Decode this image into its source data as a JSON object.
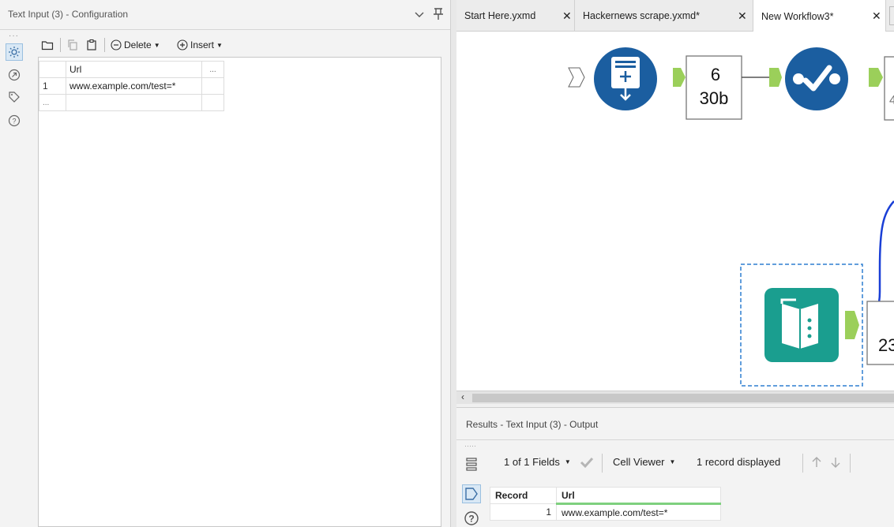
{
  "config_panel": {
    "title": "Text Input (3) - Configuration",
    "toolbar": {
      "delete_label": "Delete",
      "insert_label": "Insert"
    },
    "grid": {
      "column_header": "Url",
      "more_header": "...",
      "rows": [
        {
          "row_number": "1",
          "value": "www.example.com/test=*"
        }
      ],
      "empty_row_marker": "..."
    }
  },
  "tabs": [
    {
      "label": "Start Here.yxmd",
      "active": false
    },
    {
      "label": "Hackernews scrape.yxmd*",
      "active": false
    },
    {
      "label": "New Workflow3*",
      "active": true
    }
  ],
  "canvas": {
    "browse_badge_top": "6",
    "browse_badge_bottom": "30b",
    "textinput_badge_bottom": "23"
  },
  "results": {
    "title": "Results - Text Input (3) - Output",
    "fields_label": "1 of 1 Fields",
    "cell_viewer_label": "Cell Viewer",
    "records_label": "1 record displayed",
    "columns": [
      "Record",
      "Url"
    ],
    "rows": [
      {
        "record": "1",
        "url": "www.example.com/test=*"
      }
    ]
  },
  "colors": {
    "tool_blue": "#1b5ea0",
    "tool_teal": "#1a9e8f",
    "anchor_green": "#9bcf5a",
    "selection_dash": "#2f7fd1",
    "connector_blue": "#1a3fd6"
  }
}
